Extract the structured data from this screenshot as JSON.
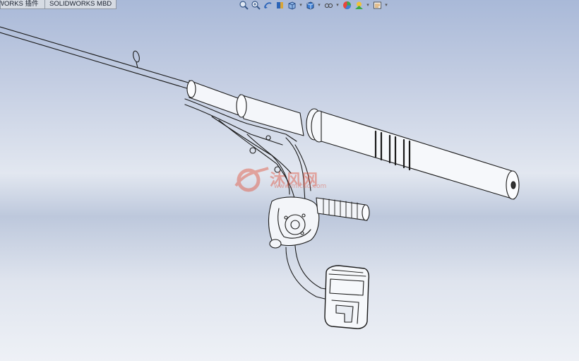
{
  "app": {
    "tabs": [
      {
        "label": "WORKS 插件"
      },
      {
        "label": "SOLIDWORKS MBD"
      }
    ]
  },
  "heads_up_toolbar": {
    "icons": [
      "zoom-to-fit-icon",
      "zoom-to-area-icon",
      "previous-view-icon",
      "section-view-icon",
      "view-orientation-icon",
      "display-style-icon",
      "hide-show-items-icon",
      "edit-appearance-icon",
      "apply-scene-icon",
      "view-settings-icon"
    ]
  },
  "watermark": {
    "text": "沐风网",
    "sub": "www.mfcad.com",
    "color": "#e0503a"
  },
  "colors": {
    "background_top": "#a9b9d8",
    "background_bottom": "#eef1f6",
    "edge_color": "#1a1a1a"
  }
}
